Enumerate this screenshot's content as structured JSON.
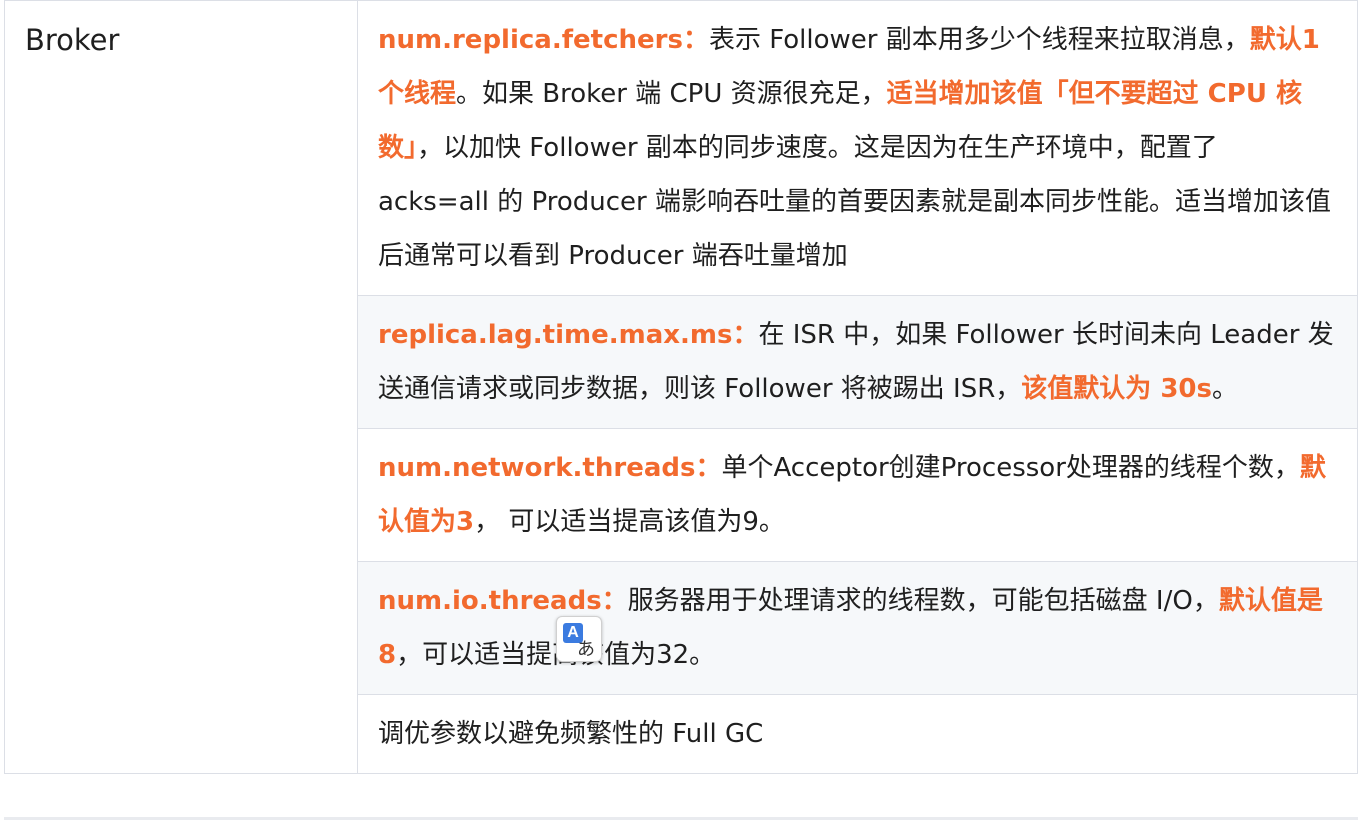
{
  "table": {
    "category": "Broker",
    "rows": [
      {
        "key": "num.replica.fetchers：",
        "parts": [
          {
            "t": "表示 Follower 副本用多少个线程来拉取消息，",
            "hl": false
          },
          {
            "t": "默认1个线程",
            "hl": true
          },
          {
            "t": "。如果 Broker 端 CPU 资源很充足，",
            "hl": false
          },
          {
            "t": "适当增加该值「但不要超过 CPU 核数」",
            "hl": true
          },
          {
            "t": "，以加快 Follower 副本的同步速度。这是因为在生产环境中，配置了 acks=all 的 Producer 端影响吞吐量的首要因素就是副本同步性能。适当增加该值后通常可以看到 Producer 端吞吐量增加",
            "hl": false
          }
        ]
      },
      {
        "key": "replica.lag.time.max.ms：",
        "parts": [
          {
            "t": "在 ISR 中，如果 Follower 长时间未向 Leader 发送通信请求或同步数据，则该 Follower 将被踢出 ISR，",
            "hl": false
          },
          {
            "t": "该值默认为 30s",
            "hl": true
          },
          {
            "t": "。",
            "hl": false
          }
        ]
      },
      {
        "key": "num.network.threads：",
        "parts": [
          {
            "t": "单个Acceptor创建Processor处理器的线程个数，",
            "hl": false
          },
          {
            "t": "默认值为3",
            "hl": true
          },
          {
            "t": "， 可以适当提高该值为9。",
            "hl": false
          }
        ]
      },
      {
        "key": "num.io.threads：",
        "parts": [
          {
            "t": "服务器用于处理请求的线程数，可能包括磁盘 I/O，",
            "hl": false
          },
          {
            "t": "默认值是 8",
            "hl": true
          },
          {
            "t": "，可以适当提高该值为32。",
            "hl": false
          }
        ]
      },
      {
        "key": "",
        "parts": [
          {
            "t": "调优参数以避免频繁性的 Full GC",
            "hl": false
          }
        ]
      }
    ]
  },
  "translate_popup": {
    "icon": "translate-icon",
    "letter_a": "A",
    "letter_b": "あ"
  },
  "colors": {
    "accent": "#f26a2e",
    "border": "#dcdfe6",
    "shade": "#f6f8fa"
  }
}
